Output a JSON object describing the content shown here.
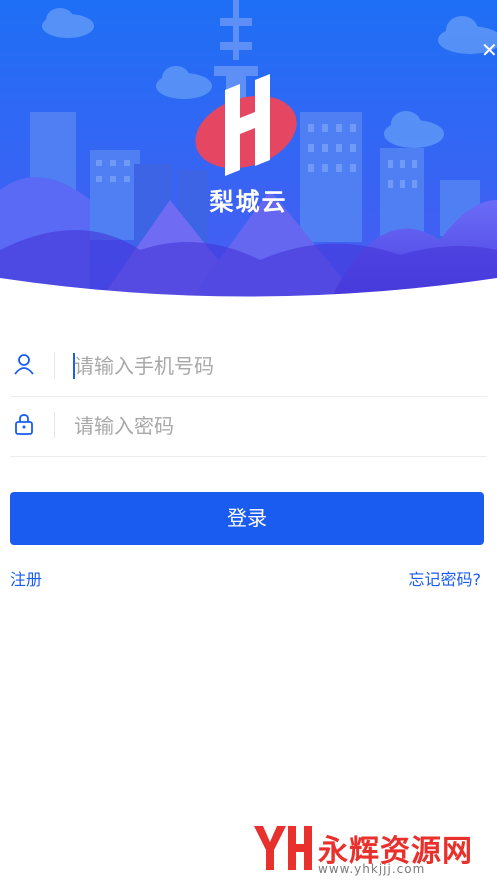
{
  "brand": {
    "name": "梨城云",
    "logo_letter": "H"
  },
  "header": {
    "close_icon": "close-icon"
  },
  "form": {
    "phone_placeholder": "请输入手机号码",
    "password_placeholder": "请输入密码",
    "user_icon": "user-icon",
    "lock_icon": "lock-icon"
  },
  "actions": {
    "login_label": "登录",
    "register_label": "注册",
    "forgot_label": "忘记密码?"
  },
  "watermark": {
    "text": "永辉资源网",
    "url": "www.yhkjjj.com"
  },
  "colors": {
    "accent": "#1a5cf0",
    "hero_top": "#1f6cf5",
    "hero_bottom": "#5b4ff0",
    "logo_blob": "#e54763",
    "watermark": "#e8302c"
  }
}
